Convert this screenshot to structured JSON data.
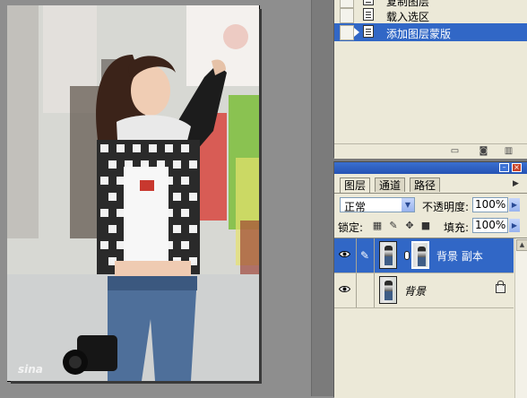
{
  "history": {
    "items": [
      {
        "label": "复制图层"
      },
      {
        "label": "载入选区"
      },
      {
        "label": "添加图层蒙版",
        "selected": true
      }
    ]
  },
  "layers_panel": {
    "tabs": [
      {
        "label": "图层"
      },
      {
        "label": "通道"
      },
      {
        "label": "路径"
      }
    ],
    "blend_mode": "正常",
    "opacity_label": "不透明度:",
    "opacity_value": "100%",
    "lock_label": "锁定:",
    "fill_label": "填充:",
    "fill_value": "100%",
    "layers": [
      {
        "name": "背景 副本",
        "visible": true,
        "has_mask": true,
        "selected": true
      },
      {
        "name": "背景",
        "visible": true,
        "locked": true,
        "selected": false
      }
    ]
  },
  "canvas": {
    "watermark": "sina"
  },
  "colors": {
    "selection": "#3167c6",
    "panel_bg": "#ece9d8",
    "titlebar": "#2f62c6",
    "workspace": "#8e8e8e"
  }
}
